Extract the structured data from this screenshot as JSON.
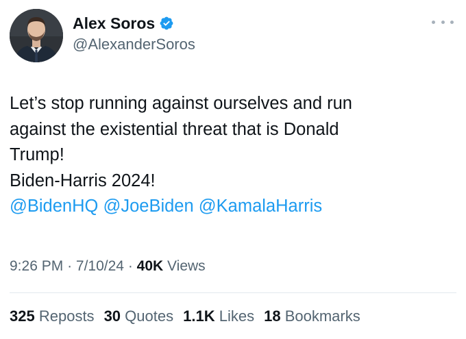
{
  "author": {
    "display_name": "Alex Soros",
    "handle": "@AlexanderSoros",
    "verified": true
  },
  "tweet": {
    "lines": [
      "Let’s stop running against ourselves and run",
      "against the existential threat that is Donald",
      "Trump!",
      "Biden-Harris 2024!"
    ],
    "mentions": [
      "@BidenHQ",
      "@JoeBiden",
      "@KamalaHarris"
    ]
  },
  "meta": {
    "time": "9:26 PM",
    "separator": "·",
    "date": "7/10/24",
    "views_count": "40K",
    "views_label": "Views"
  },
  "stats": {
    "reposts_count": "325",
    "reposts_label": "Reposts",
    "quotes_count": "30",
    "quotes_label": "Quotes",
    "likes_count": "1.1K",
    "likes_label": "Likes",
    "bookmarks_count": "18",
    "bookmarks_label": "Bookmarks"
  },
  "colors": {
    "link": "#1d9bf0",
    "secondary_text": "#536471",
    "primary_text": "#0f1419",
    "verified_badge": "#1d9bf0"
  },
  "icons": {
    "verified": "verified-badge-icon",
    "more": "more-options-icon"
  }
}
